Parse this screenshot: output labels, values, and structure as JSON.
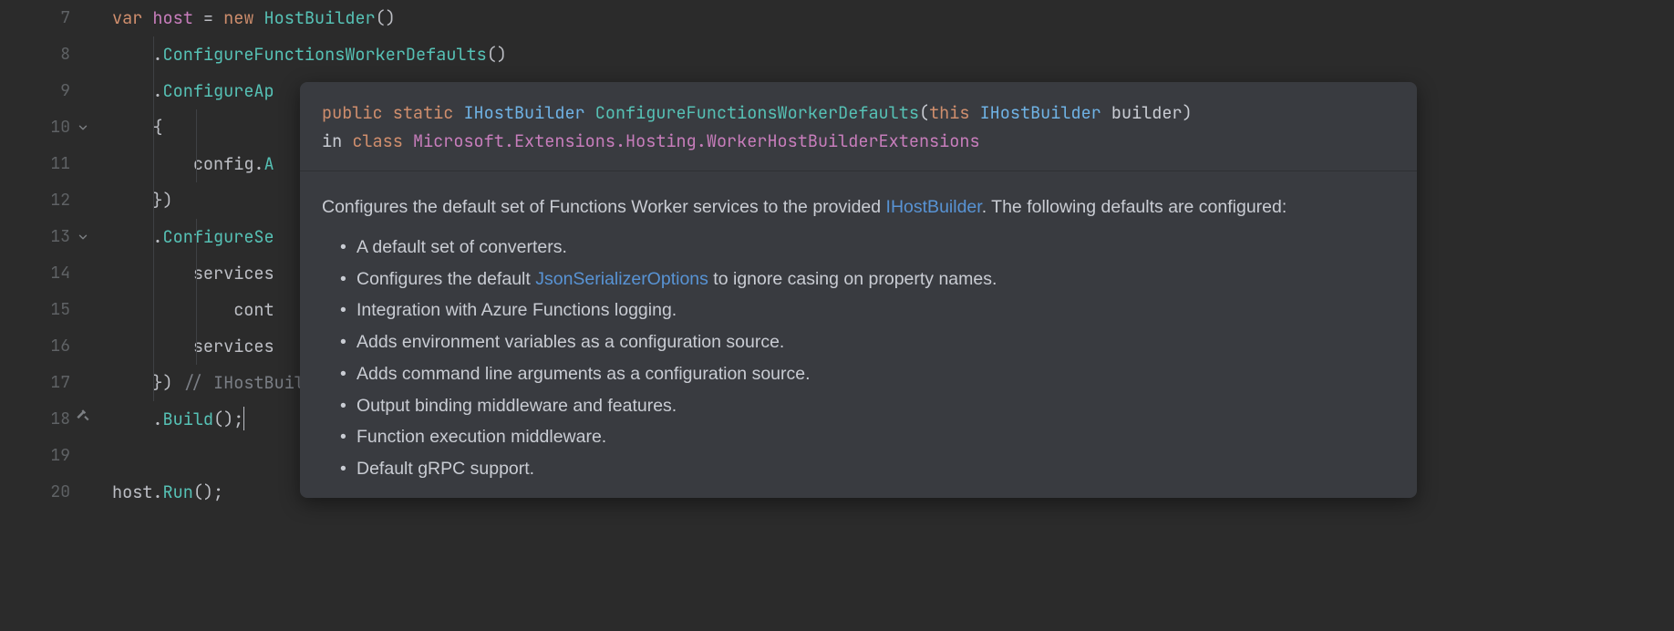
{
  "code": {
    "lines": [
      {
        "n": "7"
      },
      {
        "n": "8"
      },
      {
        "n": "9"
      },
      {
        "n": "10",
        "fold": true
      },
      {
        "n": "11"
      },
      {
        "n": "12"
      },
      {
        "n": "13",
        "fold": true
      },
      {
        "n": "14"
      },
      {
        "n": "15"
      },
      {
        "n": "16"
      },
      {
        "n": "17"
      },
      {
        "n": "18",
        "hammer": true
      },
      {
        "n": "19"
      },
      {
        "n": "20"
      }
    ],
    "l7_var": "var",
    "l7_host": "host",
    "l7_eq": " = ",
    "l7_new": "new ",
    "l7_type": "HostBuilder",
    "l7_p": "()",
    "l8_dot": ".",
    "l8_m": "ConfigureFunctionsWorkerDefaults",
    "l8_p": "()",
    "l9_dot": ".",
    "l9_m": "ConfigureAp",
    "l10": "{",
    "l11_a": "config.",
    "l11_b": "A",
    "l12": "})",
    "l13_dot": ".",
    "l13_m": "ConfigureSe",
    "l14": "services",
    "l15": "cont",
    "l16": "services",
    "l17_a": "}) ",
    "l17_cmt": "// IHostBuilde",
    "l18_dot": ".",
    "l18_m": "Build",
    "l18_p": "();",
    "l20_a": "host.",
    "l20_m": "Run",
    "l20_p": "();"
  },
  "tooltip": {
    "sig_kw_public": "public",
    "sig_kw_static": "static",
    "sig_type1": "IHostBuilder",
    "sig_method": "ConfigureFunctionsWorkerDefaults",
    "sig_kw_this": "this",
    "sig_type2": "IHostBuilder",
    "sig_param": "builder",
    "sig_in": " in ",
    "sig_kw_class": "class",
    "sig_ns": "Microsoft.Extensions.Hosting.WorkerHostBuilderExtensions",
    "desc_a": "Configures the default set of Functions Worker services to the provided ",
    "desc_link": "IHostBuilder",
    "desc_b": ". The following defaults are configured:",
    "bullets": [
      {
        "pre": "A default set of converters.",
        "link": "",
        "post": ""
      },
      {
        "pre": "Configures the default ",
        "link": "JsonSerializerOptions",
        "post": " to ignore casing on property names."
      },
      {
        "pre": "Integration with Azure Functions logging.",
        "link": "",
        "post": ""
      },
      {
        "pre": "Adds environment variables as a configuration source.",
        "link": "",
        "post": ""
      },
      {
        "pre": "Adds command line arguments as a configuration source.",
        "link": "",
        "post": ""
      },
      {
        "pre": "Output binding middleware and features.",
        "link": "",
        "post": ""
      },
      {
        "pre": "Function execution middleware.",
        "link": "",
        "post": ""
      },
      {
        "pre": "Default gRPC support.",
        "link": "",
        "post": ""
      }
    ]
  }
}
